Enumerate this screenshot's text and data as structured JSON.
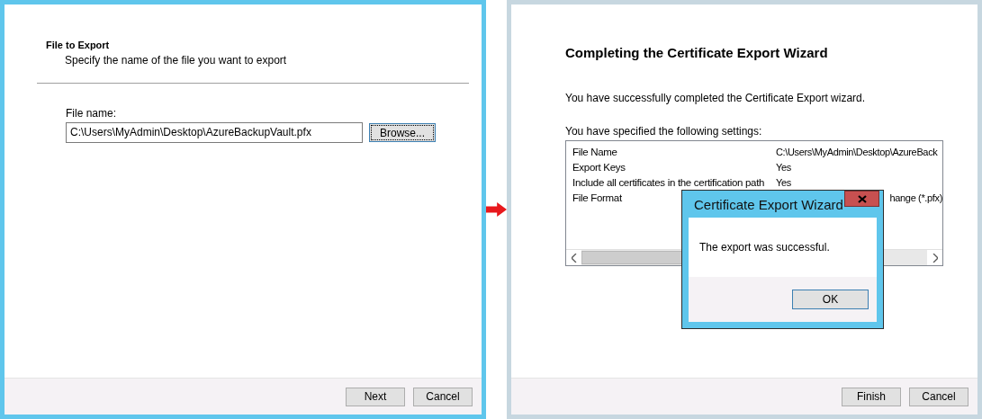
{
  "export_window": {
    "active": true,
    "section_title": "File to Export",
    "section_subtitle": "Specify the name of the file you want to export",
    "file_name": {
      "label": "File name:",
      "value": "C:\\Users\\MyAdmin\\Desktop\\AzureBackupVault.pfx"
    },
    "browse_button": {
      "label": "Browse...",
      "focused": true
    },
    "buttons": [
      {
        "label": "Next"
      },
      {
        "label": "Cancel"
      }
    ]
  },
  "completion_window": {
    "active": false,
    "title": "Completing the Certificate Export Wizard",
    "message": "You have successfully completed the Certificate Export wizard.",
    "settings_label": "You have specified the following settings:",
    "settings": [
      {
        "kind": "full",
        "name": "File Name",
        "value": "C:\\Users\\MyAdmin\\Desktop\\AzureBack"
      },
      {
        "kind": "full",
        "name": "Export Keys",
        "value": "Yes"
      },
      {
        "kind": "full",
        "name": "Include all certificates in the certification path",
        "value": "Yes"
      },
      {
        "kind": "tail",
        "name": "File Format",
        "value": "hange (*.pfx)"
      }
    ],
    "buttons": [
      {
        "label": "Finish"
      },
      {
        "label": "Cancel"
      }
    ]
  },
  "message_box": {
    "title": "Certificate Export Wizard",
    "message": "The export was successful.",
    "button": "OK"
  }
}
